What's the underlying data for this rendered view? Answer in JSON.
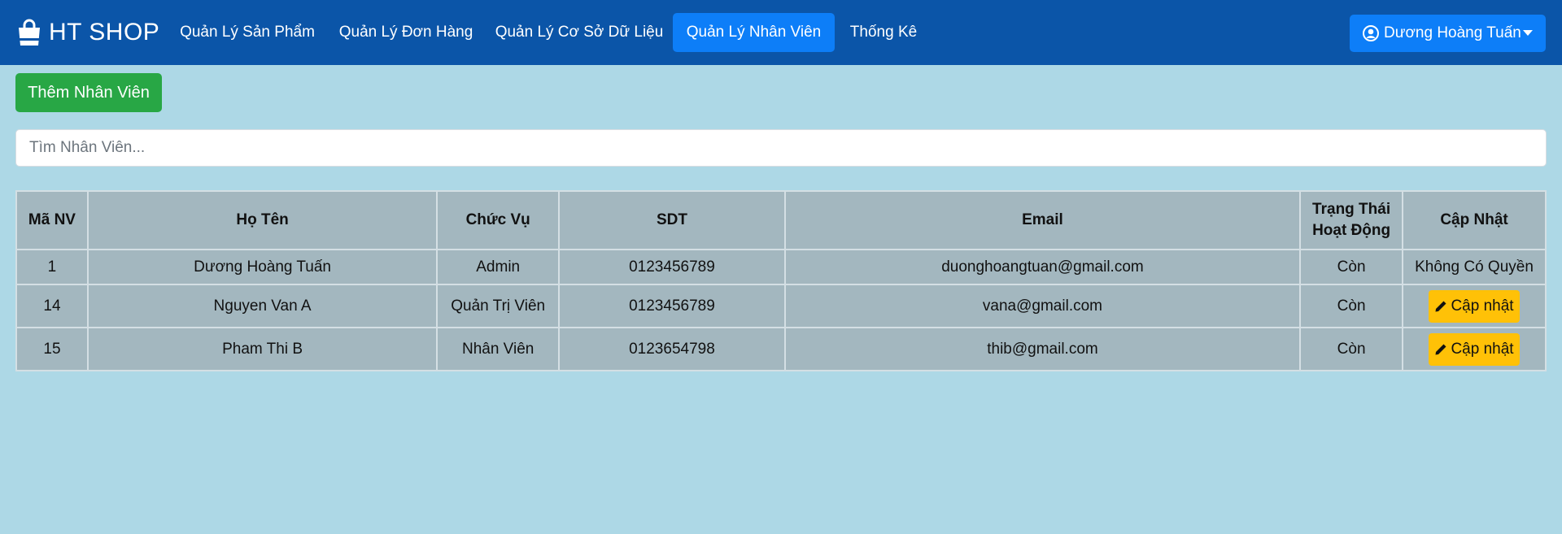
{
  "brand": {
    "name": "HT SHOP",
    "icon": "shopping-bag-icon"
  },
  "nav": {
    "items": [
      {
        "label": "Quản Lý Sản Phẩm"
      },
      {
        "label": "Quản Lý Đơn Hàng"
      },
      {
        "label": "Quản Lý Cơ Sở Dữ Liệu"
      },
      {
        "label": "Quản Lý Nhân Viên",
        "active": true
      },
      {
        "label": "Thống Kê"
      }
    ],
    "user": {
      "name": "Dương Hoàng Tuấn",
      "icon": "user-circle-icon"
    }
  },
  "actions": {
    "add_label": "Thêm Nhân Viên"
  },
  "search": {
    "placeholder": "Tìm Nhân Viên...",
    "value": ""
  },
  "table": {
    "headers": [
      "Mã NV",
      "Họ Tên",
      "Chức Vụ",
      "SDT",
      "Email",
      "Trạng Thái Hoạt Động",
      "Cập Nhật"
    ],
    "rows": [
      {
        "id": "1",
        "name": "Dương Hoàng Tuấn",
        "role": "Admin",
        "phone": "0123456789",
        "email": "duonghoangtuan@gmail.com",
        "status": "Còn",
        "update": "Không Có Quyền"
      },
      {
        "id": "14",
        "name": "Nguyen Van A",
        "role": "Quản Trị Viên",
        "phone": "0123456789",
        "email": "vana@gmail.com",
        "status": "Còn",
        "update": "Cập nhật"
      },
      {
        "id": "15",
        "name": "Pham Thi B",
        "role": "Nhân Viên",
        "phone": "0123654798",
        "email": "thib@gmail.com",
        "status": "Còn",
        "update": "Cập nhật"
      }
    ]
  },
  "colors": {
    "navbar": "#0b55a8",
    "active_nav": "#0d7ef8",
    "page_background": "#add8e6",
    "add_button": "#28a745",
    "update_button": "#ffc107",
    "table_background": "#a3b7bf"
  }
}
